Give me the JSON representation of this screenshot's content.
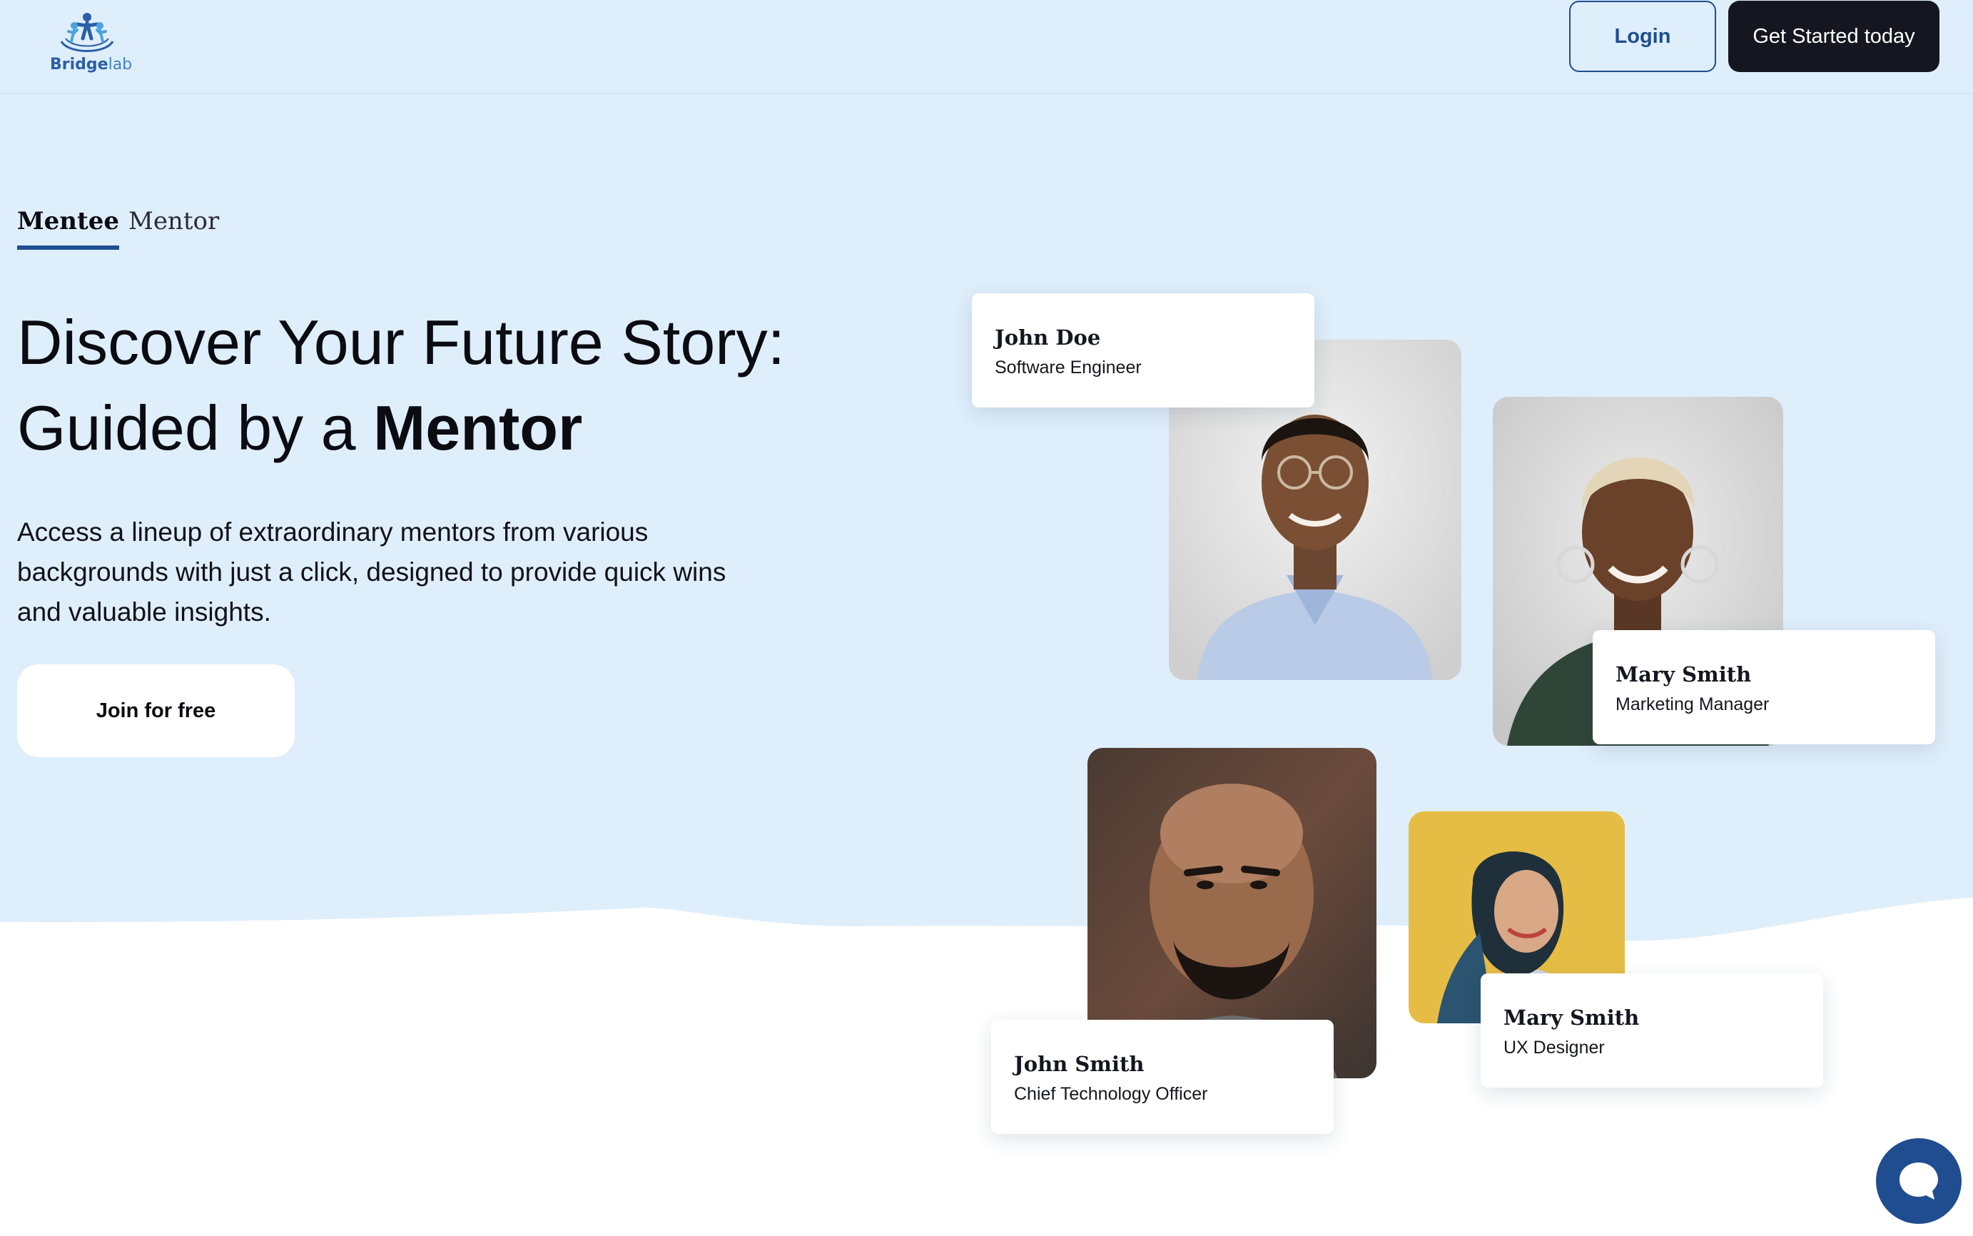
{
  "brand": {
    "name_part1": "Bridge",
    "name_part2": "lab"
  },
  "header": {
    "login_label": "Login",
    "get_started_label": "Get Started today"
  },
  "tabs": [
    {
      "label": "Mentee",
      "active": true
    },
    {
      "label": "Mentor",
      "active": false
    }
  ],
  "hero": {
    "headline_line1": "Discover Your Future Story:",
    "headline_line2_prefix": "Guided by a ",
    "headline_line2_emphasis": "Mentor",
    "description": "Access a lineup of extraordinary mentors from various backgrounds with just a click, designed to provide quick wins and valuable insights.",
    "cta_label": "Join for free"
  },
  "mentors": [
    {
      "name": "John Doe",
      "role": "Software Engineer"
    },
    {
      "name": "Mary Smith",
      "role": "Marketing Manager"
    },
    {
      "name": "John Smith",
      "role": "Chief Technology Officer"
    },
    {
      "name": "Mary Smith",
      "role": "UX Designer"
    }
  ],
  "colors": {
    "hero_background": "#dfeefb",
    "accent": "#1f4d8f",
    "dark_button": "#161620",
    "chat_button": "#1f4d8f"
  },
  "icons": {
    "logo": "bridgelab-logo",
    "chat": "chat-bubble-icon"
  }
}
